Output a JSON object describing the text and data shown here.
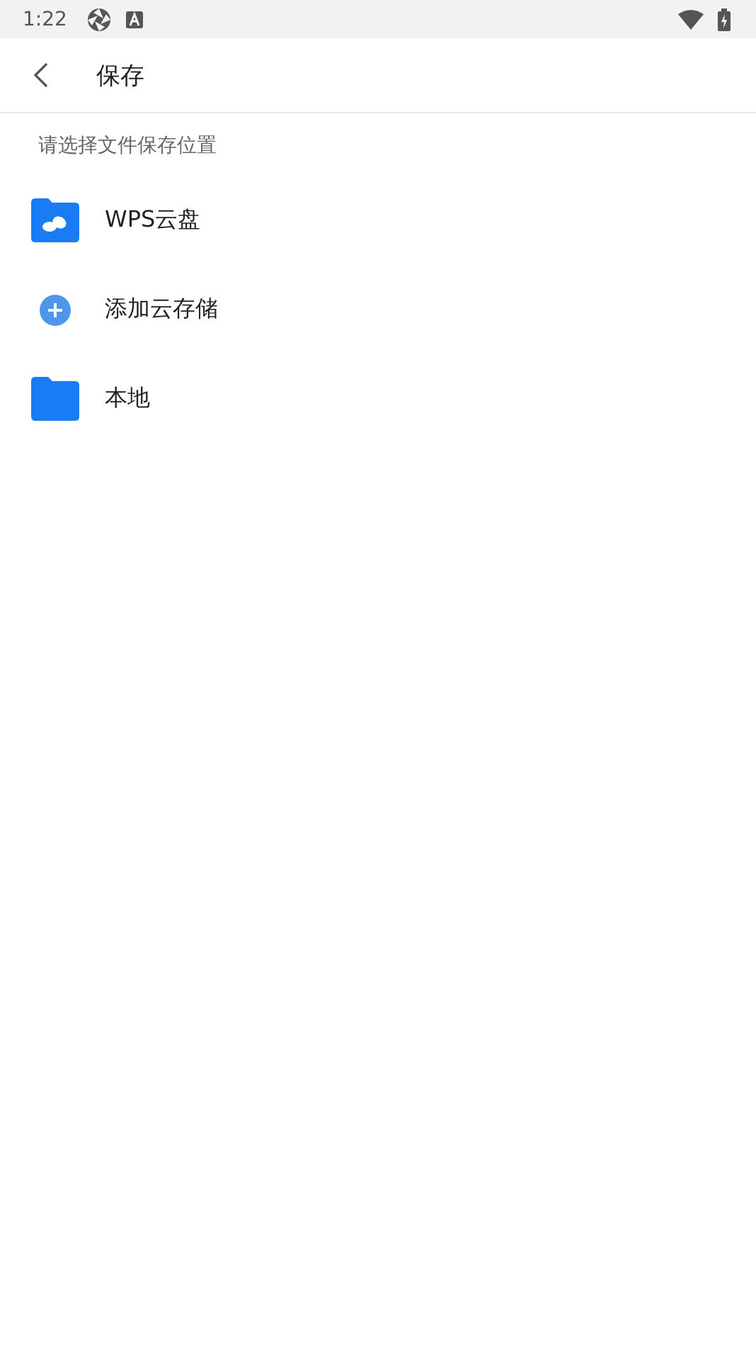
{
  "status_bar": {
    "time": "1:22"
  },
  "header": {
    "title": "保存"
  },
  "section": {
    "label": "请选择文件保存位置"
  },
  "items": [
    {
      "kind": "cloud-folder",
      "label": "WPS云盘"
    },
    {
      "kind": "add",
      "label": "添加云存储"
    },
    {
      "kind": "folder",
      "label": "本地"
    }
  ]
}
